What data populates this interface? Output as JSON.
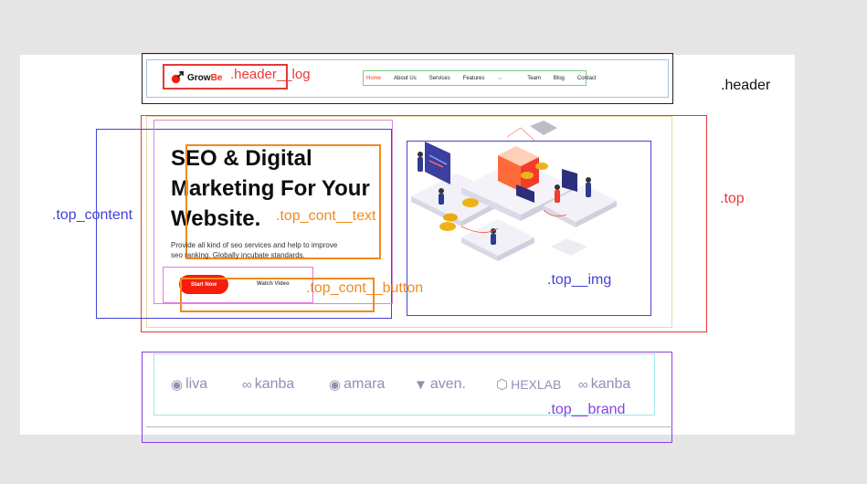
{
  "header": {
    "logo_prefix": "Grow",
    "logo_accent": "Be",
    "nav": [
      "Home",
      "About Us",
      "Services",
      "Features",
      "Team",
      "Blog",
      "Contact"
    ]
  },
  "hero": {
    "title_lines": [
      "SEO & Digital",
      "Marketing For Your",
      "Website."
    ],
    "description_lines": [
      "Provide all kind of seo services and help to improve",
      "seo ranking. Globally incubate standards."
    ],
    "start_button": "Start Now",
    "watch_button": "Watch Video"
  },
  "brands": [
    {
      "name": "liva",
      "icon": "puzzle-icon"
    },
    {
      "name": "kanba",
      "icon": "trefoil-icon"
    },
    {
      "name": "amara",
      "icon": "a-circle-icon"
    },
    {
      "name": "aven.",
      "icon": "bird-icon"
    },
    {
      "name": "HEXLAB",
      "icon": "hexagon-icon"
    },
    {
      "name": "kanba",
      "icon": "trefoil-icon"
    }
  ],
  "annotations": {
    "header": ".header",
    "header_logo": ".header__log",
    "top": ".top",
    "top_content": ".top_content",
    "top_cont_text": ".top_cont__text",
    "top_cont_button": ".top_cont__button",
    "top_img": ".top__img",
    "top_brand": ".top__brand"
  },
  "colors": {
    "brand_red": "#f51d0b",
    "annotation_red": "#ef3939",
    "annotation_orange": "#f28a1c",
    "annotation_blue": "#4343d6",
    "annotation_purple": "#8642e8",
    "brand_grey": "#8f92b3"
  }
}
